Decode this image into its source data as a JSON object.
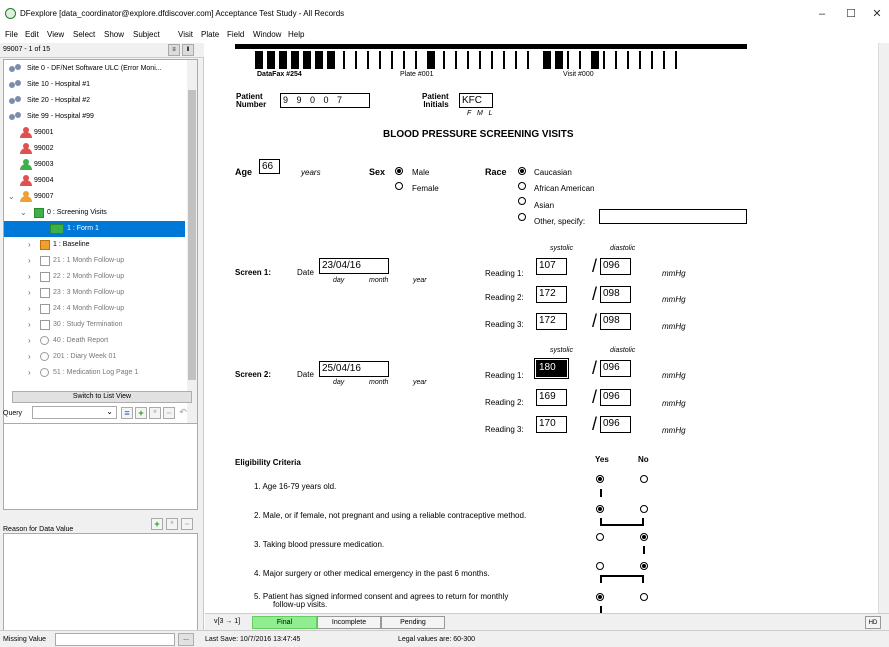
{
  "window": {
    "title": "DFexplore [data_coordinator@explore.dfdiscover.com] Acceptance Test Study - All Records",
    "min": "–",
    "max": "☐",
    "close": "✕"
  },
  "menu": [
    "File",
    "Edit",
    "View",
    "Select",
    "Show",
    "Subject",
    "Visit",
    "Plate",
    "Field",
    "Window",
    "Help"
  ],
  "left": {
    "record_count": "99007 - 1 of 15",
    "sites": [
      "Site 0 - DF/Net Software ULC (Error Moni...",
      "Site 10 - Hospital #1",
      "Site 20 - Hospital #2",
      "Site 99 - Hospital #99"
    ],
    "patients": [
      "99001",
      "99002",
      "99003",
      "99004",
      "99007"
    ],
    "visits": [
      "0 : Screening Visits",
      "1 : Form 1",
      "1 : Baseline",
      "21 : 1 Month Follow-up",
      "22 : 2 Month Follow-up",
      "23 : 3 Month Follow-up",
      "24 : 4 Month Follow-up",
      "30 : Study Termination",
      "40 : Death Report",
      "201 : Diary Week 01",
      "51 : Medication Log Page 1"
    ],
    "switch_view": "Switch to List View",
    "query_label": "Query",
    "reason_label": "Reason for Data Value",
    "missing_label": "Missing Value",
    "missing_btn": "..."
  },
  "form": {
    "header": {
      "fax": "DataFax #254",
      "plate": "Plate #001",
      "visit": "Visit #000"
    },
    "patient_number_label": "Patient\nNumber",
    "patient_number": "9 9 0 0 7",
    "patient_initials_label": "Patient\nInitials",
    "patient_initials": "KFC",
    "initials_hint": "F   M   L",
    "title": "BLOOD PRESSURE SCREENING VISITS",
    "age_label": "Age",
    "age": "66",
    "years": "years",
    "sex_label": "Sex",
    "sex_options": [
      "Male",
      "Female"
    ],
    "race_label": "Race",
    "race_options": [
      "Caucasian",
      "African American",
      "Asian",
      "Other, specify:"
    ],
    "screen1": {
      "label": "Screen 1:",
      "date_label": "Date",
      "date": "23/04/16"
    },
    "screen2": {
      "label": "Screen 2:",
      "date_label": "Date",
      "date": "25/04/16"
    },
    "date_hint": {
      "day": "day",
      "month": "month",
      "year": "year"
    },
    "systolic": "systolic",
    "diastolic": "diastolic",
    "mmhg": "mmHg",
    "reading_labels": [
      "Reading 1:",
      "Reading 2:",
      "Reading 3:"
    ],
    "readings1": [
      [
        "107",
        "096"
      ],
      [
        "172",
        "098"
      ],
      [
        "172",
        "098"
      ]
    ],
    "readings2": [
      [
        "180",
        "096"
      ],
      [
        "169",
        "096"
      ],
      [
        "170",
        "096"
      ]
    ],
    "eligibility_title": "Eligibility Criteria",
    "yes": "Yes",
    "no": "No",
    "criteria": [
      "1.   Age 16-79 years old.",
      "2.   Male, or if female, not pregnant and using a reliable contraceptive method.",
      "3.   Taking blood pressure medication.",
      "4.   Major surgery or other medical emergency in the past 6 months.",
      "5.   Patient has signed informed consent and agrees to return for monthly",
      "follow-up visits."
    ]
  },
  "status": {
    "version": "v[3 → 1]",
    "final": "Final",
    "incomplete": "Incomplete",
    "pending": "Pending",
    "hd": "HD"
  },
  "bottom": {
    "last_save": "Last Save: 10/7/2016 13:47:45",
    "legal": "Legal values are: 60-300"
  },
  "colors": {
    "selection": "#0078d7",
    "final_green": "#90ee90",
    "patient_red": "#e05050",
    "patient_green": "#3cb04a",
    "patient_orange": "#f0a030"
  }
}
